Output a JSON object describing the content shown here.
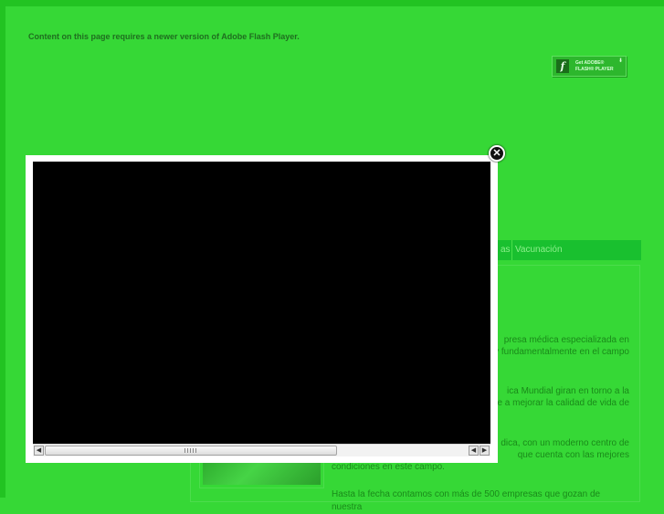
{
  "page": {
    "flash_notice": "Content on this page requires a newer version of Adobe Flash Player."
  },
  "flash_badge": {
    "line1": "Get ADOBE®",
    "line2": "FLASH® PLAYER",
    "icon": "flash-f-icon"
  },
  "nav": {
    "partial_item": "as",
    "vaccination": "Vacunación"
  },
  "content": {
    "para1_line1": "presa médica especializada en",
    "para1_line2": "y fundamentalmente en el campo",
    "para2_line1": "ica Mundial giran en torno a la",
    "para2_line2": "de a mejorar la calidad de vida de",
    "para3_line1": "dica, con un moderno centro de",
    "para3_line2": "que cuenta con las mejores",
    "para3_line3": "condiciones en este campo.",
    "para4_line1": "Hasta la fecha contamos con más de 500 empresas que gozan de nuestra"
  },
  "modal": {
    "close_symbol": "✕",
    "scroll_left": "◀",
    "scroll_right": "▶"
  },
  "colors": {
    "background": "#36d836",
    "nav": "#19c02f",
    "video": "#000000"
  }
}
